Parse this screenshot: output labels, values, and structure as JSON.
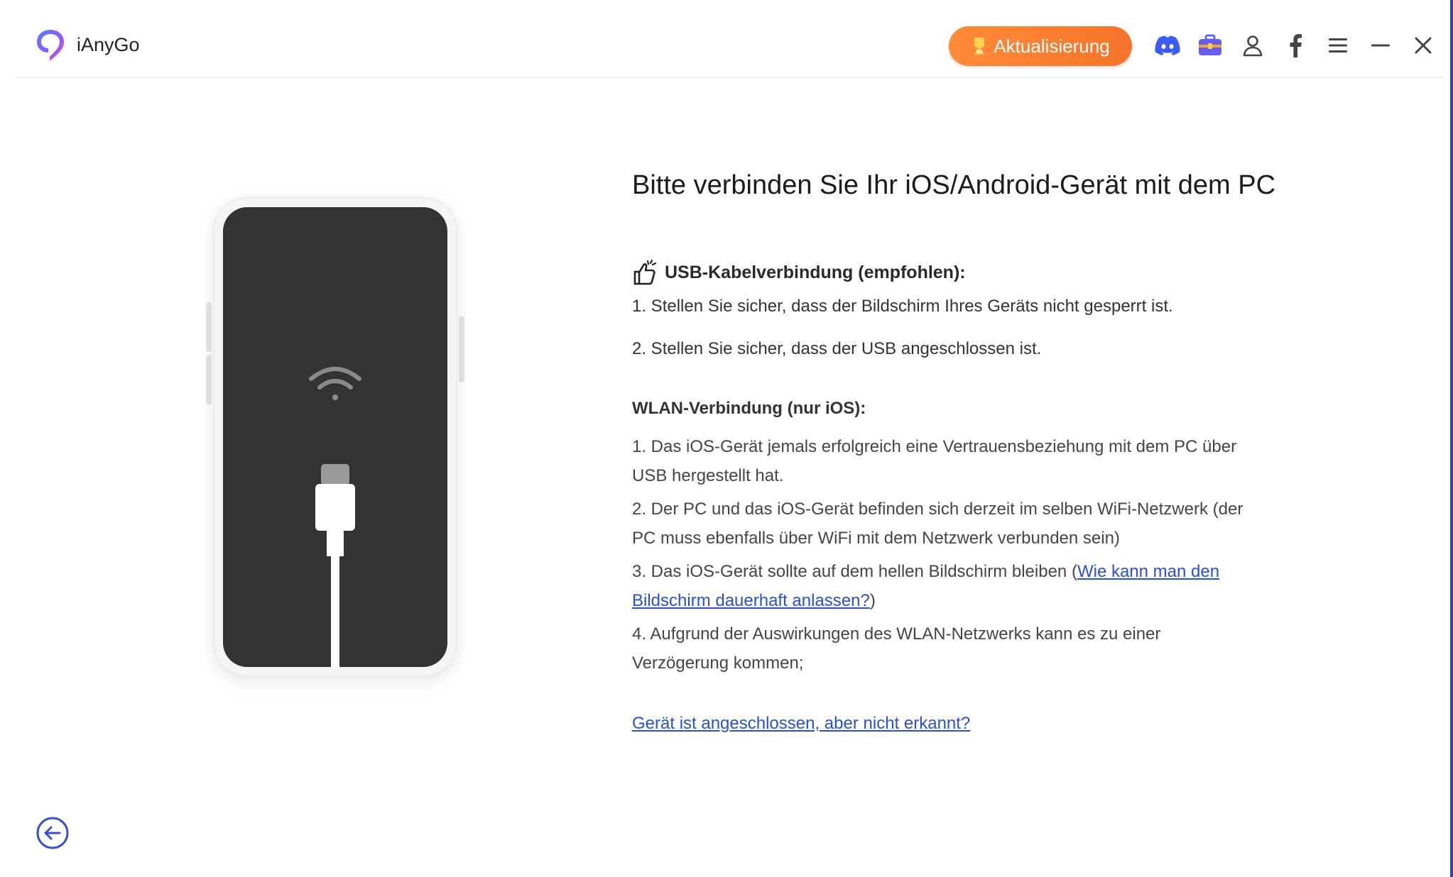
{
  "app": {
    "name": "iAnyGo"
  },
  "toolbar": {
    "upgrade_label": "Aktualisierung",
    "icons": [
      "discord-icon",
      "toolbox-icon",
      "account-icon",
      "facebook-icon",
      "menu-icon",
      "minimize-icon",
      "close-icon"
    ],
    "accent_color": "#f6742b"
  },
  "main": {
    "heading": "Bitte verbinden Sie Ihr iOS/Android-Gerät mit dem PC",
    "usb": {
      "title": "USB-Kabelverbindung (empfohlen):",
      "steps": [
        "1. Stellen Sie sicher, dass der Bildschirm Ihres Geräts nicht gesperrt ist.",
        "2. Stellen Sie sicher, dass der USB angeschlossen ist."
      ]
    },
    "wlan": {
      "title": "WLAN-Verbindung (nur iOS):",
      "step1_line1": "1. Das iOS-Gerät jemals erfolgreich eine Vertrauensbeziehung mit dem PC über",
      "step1_line2": "USB hergestellt hat.",
      "step2_line1": "2. Der PC und das iOS-Gerät befinden sich derzeit im selben WiFi-Netzwerk (der",
      "step2_line2": "PC muss ebenfalls über WiFi mit dem Netzwerk verbunden sein)",
      "step3_text": "3. Das iOS-Gerät sollte auf dem hellen Bildschirm bleiben",
      "step3_paren_open": " (",
      "step3_link_line1": "Wie kann man den",
      "step3_link_line2": "Bildschirm dauerhaft anlassen?",
      "step3_paren_close": ")",
      "step4_line1": "4. Aufgrund der Auswirkungen des WLAN-Netzwerks kann es zu einer",
      "step4_line2": "Verzögerung kommen;"
    },
    "help_link": "Gerät ist angeschlossen, aber nicht erkannt?"
  },
  "colors": {
    "link": "#2a4fd6",
    "phone_screen": "#333333",
    "back_icon": "#3b4fd0"
  }
}
